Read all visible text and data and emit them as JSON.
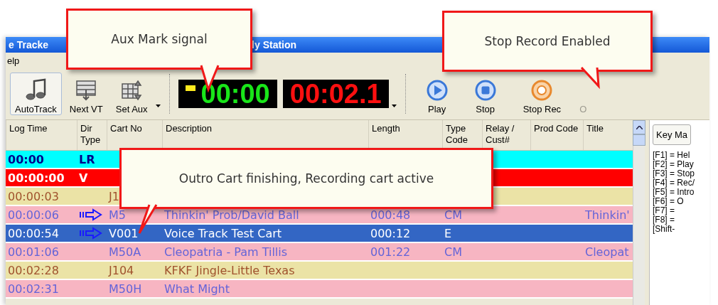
{
  "window": {
    "title_parts": [
      "e Tracke",
      "ly Station"
    ]
  },
  "menu": [
    "elp"
  ],
  "toolbar": {
    "buttons": [
      {
        "label": "AutoTrack",
        "kind": "autotrack",
        "selected": true
      },
      {
        "label": "Next VT",
        "kind": "next-vt",
        "selected": false
      },
      {
        "label": "Set Aux",
        "kind": "set-aux",
        "selected": false
      }
    ],
    "aux_mark": true,
    "elapsed": "00:00",
    "remaining": "00:02.1",
    "transport": [
      {
        "label": "Play",
        "kind": "play"
      },
      {
        "label": "Stop",
        "kind": "stop"
      },
      {
        "label": "Stop Rec",
        "kind": "stop-rec"
      },
      {
        "label": "O",
        "kind": "faded"
      }
    ]
  },
  "table": {
    "columns": [
      "Log Time",
      "Dir Type",
      "Cart No",
      "Description",
      "Length",
      "Type Code",
      "Relay / Cust#",
      "Prod Code",
      "Title"
    ],
    "rows": [
      {
        "kind": "marker",
        "selected": false,
        "cued": false,
        "log_time": "00:00",
        "dir_type": "LR"
      },
      {
        "kind": "voice",
        "selected": false,
        "cued": false,
        "log_time": "00:00:00",
        "dir_type": "V"
      },
      {
        "kind": "jingle",
        "selected": false,
        "cued": false,
        "log_time": "00:00:03",
        "cart_no": "J1"
      },
      {
        "kind": "spot",
        "selected": false,
        "cued": true,
        "log_time": "00:00:06",
        "cart_no": "M5",
        "description": "Thinkin' Prob/David Ball",
        "length": "000:48",
        "type_code": "CM",
        "title": "Thinkin'"
      },
      {
        "kind": "spot",
        "selected": true,
        "cued": true,
        "log_time": "00:00:54",
        "cart_no": "V001",
        "description": "Voice Track Test Cart",
        "length": "000:12",
        "type_code": "E"
      },
      {
        "kind": "spot",
        "selected": false,
        "cued": false,
        "log_time": "00:01:06",
        "cart_no": "M50A",
        "description": "Cleopatria - Pam Tillis",
        "length": "001:22",
        "type_code": "CM",
        "title": "Cleopat"
      },
      {
        "kind": "jingle",
        "selected": false,
        "cued": false,
        "log_time": "00:02:28",
        "cart_no": "J104",
        "description": "KFKF Jingle-Little Texas"
      },
      {
        "kind": "spot",
        "selected": false,
        "cued": false,
        "log_time": "00:02:31",
        "cart_no": "M50H",
        "description": "What Might"
      }
    ]
  },
  "key_panel": {
    "tab": "Key Ma",
    "items": [
      "[F1] = Hel",
      "[F2] = Play",
      "[F3] = Stop",
      "[F4] = Rec/",
      "[F5] = Intro",
      "[F6] = O",
      "[F7] =",
      "[F8] =",
      "[Shift-"
    ]
  },
  "callouts": [
    {
      "text": "Aux Mark signal"
    },
    {
      "text": "Stop Record Enabled"
    },
    {
      "text": "Outro Cart finishing, Recording cart active"
    }
  ]
}
